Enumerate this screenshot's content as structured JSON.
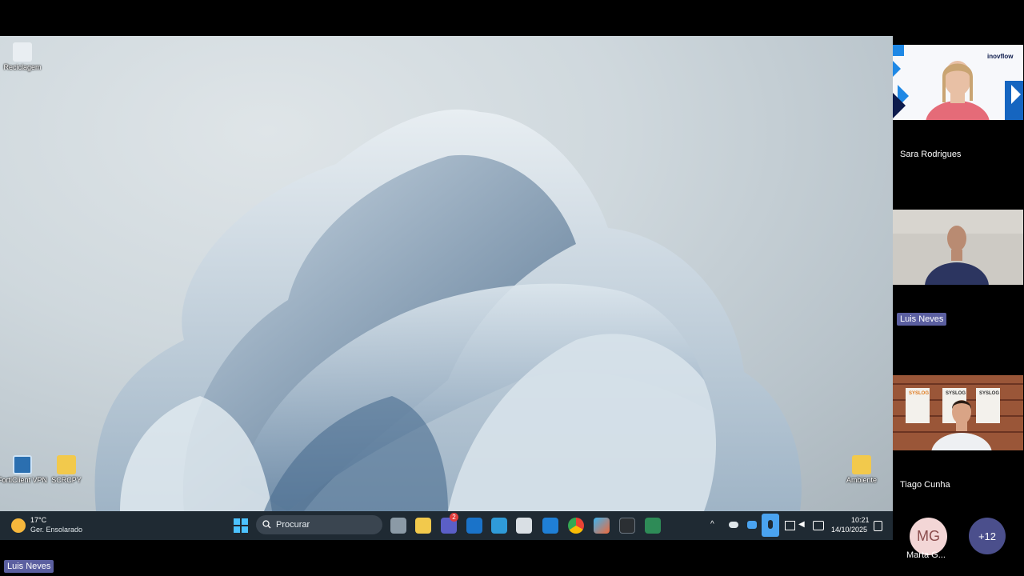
{
  "desktop": {
    "icons": [
      {
        "label": "Reciclagem",
        "icon": "recycle-bin-icon"
      },
      {
        "label": "FortiClient VPN",
        "icon": "forticlient-icon"
      },
      {
        "label": "SCRCPY",
        "icon": "folder-icon"
      },
      {
        "label": "Ambiente",
        "icon": "folder-icon"
      }
    ]
  },
  "taskbar": {
    "weather_temp": "17°C",
    "weather_desc": "Ger. Ensolarado",
    "search_placeholder": "Procurar",
    "teams_badge": "2",
    "time": "10:21",
    "date": "14/10/2025"
  },
  "meeting": {
    "participants": [
      {
        "name": "Sara Rodrigues",
        "logo": "inovflow"
      },
      {
        "name": "Luis Neves"
      },
      {
        "name": "Tiago Cunha"
      }
    ],
    "extra_avatar": {
      "initials": "MG",
      "name": "Marta G..."
    },
    "more_count": "+12",
    "presenter_label": "Luis Neves",
    "tile3_posters": [
      "SYSLOG",
      "SYSLOG",
      "SYSLOG"
    ]
  },
  "colors": {
    "taskbar_bg": "#1f2a33",
    "highlight_name_bg": "#5b5fa0",
    "avatar_mg_bg": "#f3d6d6",
    "more_bg": "#4b4f8c"
  }
}
